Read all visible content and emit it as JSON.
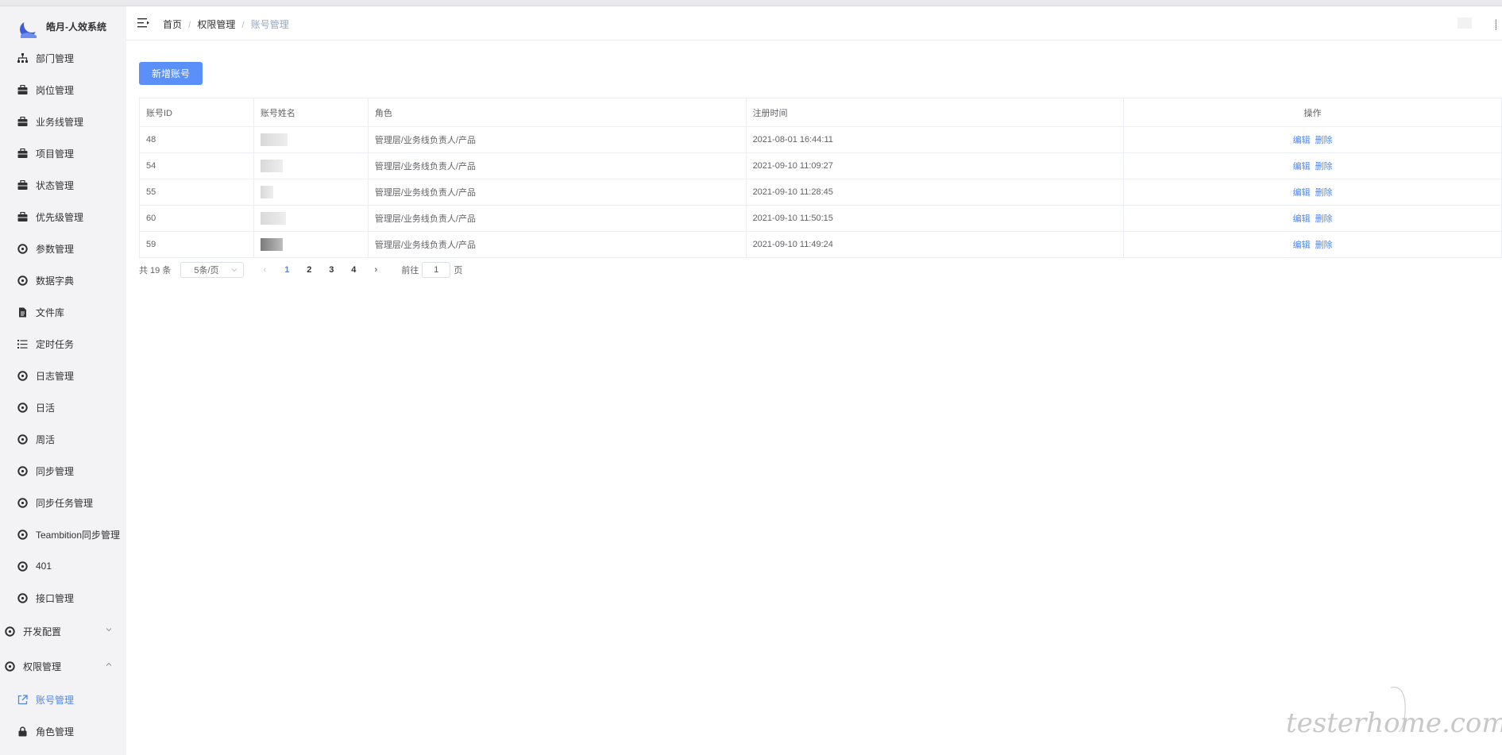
{
  "app": {
    "title": "皓月-人效系统"
  },
  "sidebar": {
    "items": [
      {
        "label": "部门管理",
        "icon": "sitemap-icon"
      },
      {
        "label": "岗位管理",
        "icon": "briefcase-icon"
      },
      {
        "label": "业务线管理",
        "icon": "briefcase-icon"
      },
      {
        "label": "项目管理",
        "icon": "briefcase-icon"
      },
      {
        "label": "状态管理",
        "icon": "briefcase-icon"
      },
      {
        "label": "优先级管理",
        "icon": "briefcase-icon"
      },
      {
        "label": "参数管理",
        "icon": "gear-icon"
      },
      {
        "label": "数据字典",
        "icon": "gear-icon"
      },
      {
        "label": "文件库",
        "icon": "file-icon"
      },
      {
        "label": "定时任务",
        "icon": "list-icon"
      },
      {
        "label": "日志管理",
        "icon": "gear-icon"
      },
      {
        "label": "日活",
        "icon": "gear-icon"
      },
      {
        "label": "周活",
        "icon": "gear-icon"
      },
      {
        "label": "同步管理",
        "icon": "gear-icon"
      },
      {
        "label": "同步任务管理",
        "icon": "gear-icon"
      },
      {
        "label": "Teambition同步管理",
        "icon": "gear-icon"
      },
      {
        "label": "401",
        "icon": "gear-icon"
      },
      {
        "label": "接口管理",
        "icon": "gear-icon"
      }
    ],
    "groups": [
      {
        "label": "开发配置",
        "icon": "gear-icon"
      },
      {
        "label": "权限管理",
        "icon": "gear-icon"
      }
    ],
    "sub": [
      {
        "label": "账号管理",
        "icon": "external-link-icon"
      },
      {
        "label": "角色管理",
        "icon": "lock-icon"
      }
    ]
  },
  "breadcrumb": {
    "home": "首页",
    "parent": "权限管理",
    "current": "账号管理"
  },
  "toolbar": {
    "add_label": "新增账号"
  },
  "table": {
    "headers": [
      "账号ID",
      "账号姓名",
      "角色",
      "注册时间",
      "操作"
    ],
    "rows": [
      {
        "id": "48",
        "role": "管理层/业务线负责人/产品",
        "time": "2021-08-01 16:44:11"
      },
      {
        "id": "54",
        "role": "管理层/业务线负责人/产品",
        "time": "2021-09-10 11:09:27"
      },
      {
        "id": "55",
        "role": "管理层/业务线负责人/产品",
        "time": "2021-09-10 11:28:45"
      },
      {
        "id": "60",
        "role": "管理层/业务线负责人/产品",
        "time": "2021-09-10 11:50:15"
      },
      {
        "id": "59",
        "role": "管理层/业务线负责人/产品",
        "time": "2021-09-10 11:49:24"
      }
    ],
    "edit_label": "编辑",
    "delete_label": "删除"
  },
  "pagination": {
    "total": "共 19 条",
    "page_size": "5条/页",
    "pages": [
      "1",
      "2",
      "3",
      "4"
    ],
    "current": "1",
    "goto_prefix": "前往",
    "goto_value": "1",
    "goto_suffix": "页"
  },
  "watermark": {
    "text": "testerhome.com"
  },
  "colors": {
    "accent": "#4e86f0",
    "button": "#5b8ff9",
    "sidebar_bg": "#f3f3f5"
  }
}
